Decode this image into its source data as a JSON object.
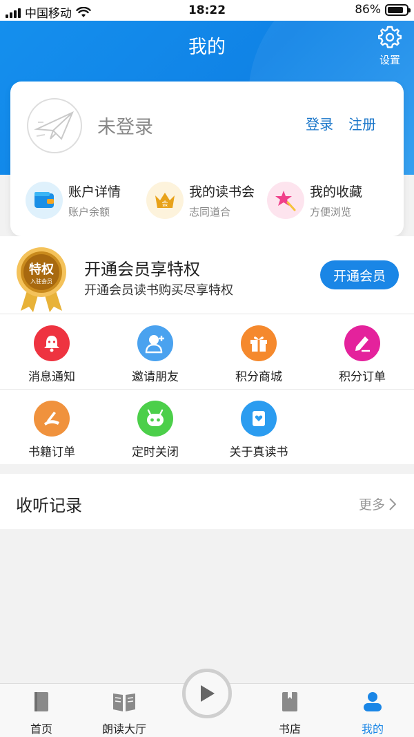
{
  "status_bar": {
    "carrier": "中国移动",
    "time": "18:22",
    "battery": "86%"
  },
  "header": {
    "title": "我的",
    "settings_label": "设置"
  },
  "profile": {
    "login_status": "未登录",
    "login_label": "登录",
    "register_label": "注册",
    "quick_items": [
      {
        "title": "账户详情",
        "subtitle": "账户余额",
        "icon": "wallet-icon"
      },
      {
        "title": "我的读书会",
        "subtitle": "志同道合",
        "icon": "crown-icon",
        "badge": "会"
      },
      {
        "title": "我的收藏",
        "subtitle": "方便浏览",
        "icon": "star-icon"
      }
    ]
  },
  "member": {
    "medal_text": "特权",
    "medal_subtext": "入驻会员",
    "title": "开通会员享特权",
    "subtitle": "开通会员读书购买尽享特权",
    "button_label": "开通会员"
  },
  "grid": [
    {
      "label": "消息通知",
      "icon": "bell-icon",
      "color": "#ee3340"
    },
    {
      "label": "邀请朋友",
      "icon": "invite-user-icon",
      "color": "#4aa2ef"
    },
    {
      "label": "积分商城",
      "icon": "gift-icon",
      "color": "#f5892d"
    },
    {
      "label": "积分订单",
      "icon": "pencil-icon",
      "color": "#e4229c"
    },
    {
      "label": "书籍订单",
      "icon": "book-order-icon",
      "color": "#f0923d"
    },
    {
      "label": "定时关闭",
      "icon": "robot-timer-icon",
      "color": "#4ccf4a"
    },
    {
      "label": "关于真读书",
      "icon": "bookmark-heart-icon",
      "color": "#2b9cf0"
    }
  ],
  "record": {
    "title": "收听记录",
    "more_label": "更多"
  },
  "tabs": [
    {
      "label": "首页",
      "icon": "book-icon",
      "active": false
    },
    {
      "label": "朗读大厅",
      "icon": "open-book-icon",
      "active": false
    },
    {
      "label": "书店",
      "icon": "bookmark-book-icon",
      "active": false
    },
    {
      "label": "我的",
      "icon": "user-icon",
      "active": true
    }
  ],
  "colors": {
    "primary": "#1a86e6",
    "link": "#1a76c9"
  }
}
